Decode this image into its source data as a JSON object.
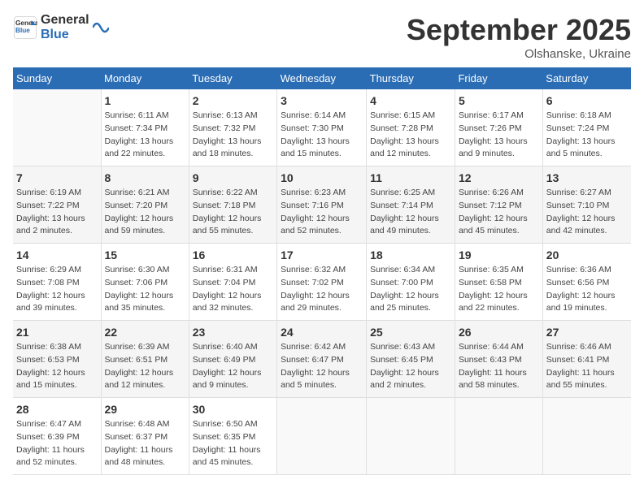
{
  "header": {
    "logo_general": "General",
    "logo_blue": "Blue",
    "month_title": "September 2025",
    "subtitle": "Olshanske, Ukraine"
  },
  "days_of_week": [
    "Sunday",
    "Monday",
    "Tuesday",
    "Wednesday",
    "Thursday",
    "Friday",
    "Saturday"
  ],
  "weeks": [
    [
      {
        "day": "",
        "info": ""
      },
      {
        "day": "1",
        "info": "Sunrise: 6:11 AM\nSunset: 7:34 PM\nDaylight: 13 hours and 22 minutes."
      },
      {
        "day": "2",
        "info": "Sunrise: 6:13 AM\nSunset: 7:32 PM\nDaylight: 13 hours and 18 minutes."
      },
      {
        "day": "3",
        "info": "Sunrise: 6:14 AM\nSunset: 7:30 PM\nDaylight: 13 hours and 15 minutes."
      },
      {
        "day": "4",
        "info": "Sunrise: 6:15 AM\nSunset: 7:28 PM\nDaylight: 13 hours and 12 minutes."
      },
      {
        "day": "5",
        "info": "Sunrise: 6:17 AM\nSunset: 7:26 PM\nDaylight: 13 hours and 9 minutes."
      },
      {
        "day": "6",
        "info": "Sunrise: 6:18 AM\nSunset: 7:24 PM\nDaylight: 13 hours and 5 minutes."
      }
    ],
    [
      {
        "day": "7",
        "info": "Sunrise: 6:19 AM\nSunset: 7:22 PM\nDaylight: 13 hours and 2 minutes."
      },
      {
        "day": "8",
        "info": "Sunrise: 6:21 AM\nSunset: 7:20 PM\nDaylight: 12 hours and 59 minutes."
      },
      {
        "day": "9",
        "info": "Sunrise: 6:22 AM\nSunset: 7:18 PM\nDaylight: 12 hours and 55 minutes."
      },
      {
        "day": "10",
        "info": "Sunrise: 6:23 AM\nSunset: 7:16 PM\nDaylight: 12 hours and 52 minutes."
      },
      {
        "day": "11",
        "info": "Sunrise: 6:25 AM\nSunset: 7:14 PM\nDaylight: 12 hours and 49 minutes."
      },
      {
        "day": "12",
        "info": "Sunrise: 6:26 AM\nSunset: 7:12 PM\nDaylight: 12 hours and 45 minutes."
      },
      {
        "day": "13",
        "info": "Sunrise: 6:27 AM\nSunset: 7:10 PM\nDaylight: 12 hours and 42 minutes."
      }
    ],
    [
      {
        "day": "14",
        "info": "Sunrise: 6:29 AM\nSunset: 7:08 PM\nDaylight: 12 hours and 39 minutes."
      },
      {
        "day": "15",
        "info": "Sunrise: 6:30 AM\nSunset: 7:06 PM\nDaylight: 12 hours and 35 minutes."
      },
      {
        "day": "16",
        "info": "Sunrise: 6:31 AM\nSunset: 7:04 PM\nDaylight: 12 hours and 32 minutes."
      },
      {
        "day": "17",
        "info": "Sunrise: 6:32 AM\nSunset: 7:02 PM\nDaylight: 12 hours and 29 minutes."
      },
      {
        "day": "18",
        "info": "Sunrise: 6:34 AM\nSunset: 7:00 PM\nDaylight: 12 hours and 25 minutes."
      },
      {
        "day": "19",
        "info": "Sunrise: 6:35 AM\nSunset: 6:58 PM\nDaylight: 12 hours and 22 minutes."
      },
      {
        "day": "20",
        "info": "Sunrise: 6:36 AM\nSunset: 6:56 PM\nDaylight: 12 hours and 19 minutes."
      }
    ],
    [
      {
        "day": "21",
        "info": "Sunrise: 6:38 AM\nSunset: 6:53 PM\nDaylight: 12 hours and 15 minutes."
      },
      {
        "day": "22",
        "info": "Sunrise: 6:39 AM\nSunset: 6:51 PM\nDaylight: 12 hours and 12 minutes."
      },
      {
        "day": "23",
        "info": "Sunrise: 6:40 AM\nSunset: 6:49 PM\nDaylight: 12 hours and 9 minutes."
      },
      {
        "day": "24",
        "info": "Sunrise: 6:42 AM\nSunset: 6:47 PM\nDaylight: 12 hours and 5 minutes."
      },
      {
        "day": "25",
        "info": "Sunrise: 6:43 AM\nSunset: 6:45 PM\nDaylight: 12 hours and 2 minutes."
      },
      {
        "day": "26",
        "info": "Sunrise: 6:44 AM\nSunset: 6:43 PM\nDaylight: 11 hours and 58 minutes."
      },
      {
        "day": "27",
        "info": "Sunrise: 6:46 AM\nSunset: 6:41 PM\nDaylight: 11 hours and 55 minutes."
      }
    ],
    [
      {
        "day": "28",
        "info": "Sunrise: 6:47 AM\nSunset: 6:39 PM\nDaylight: 11 hours and 52 minutes."
      },
      {
        "day": "29",
        "info": "Sunrise: 6:48 AM\nSunset: 6:37 PM\nDaylight: 11 hours and 48 minutes."
      },
      {
        "day": "30",
        "info": "Sunrise: 6:50 AM\nSunset: 6:35 PM\nDaylight: 11 hours and 45 minutes."
      },
      {
        "day": "",
        "info": ""
      },
      {
        "day": "",
        "info": ""
      },
      {
        "day": "",
        "info": ""
      },
      {
        "day": "",
        "info": ""
      }
    ]
  ]
}
